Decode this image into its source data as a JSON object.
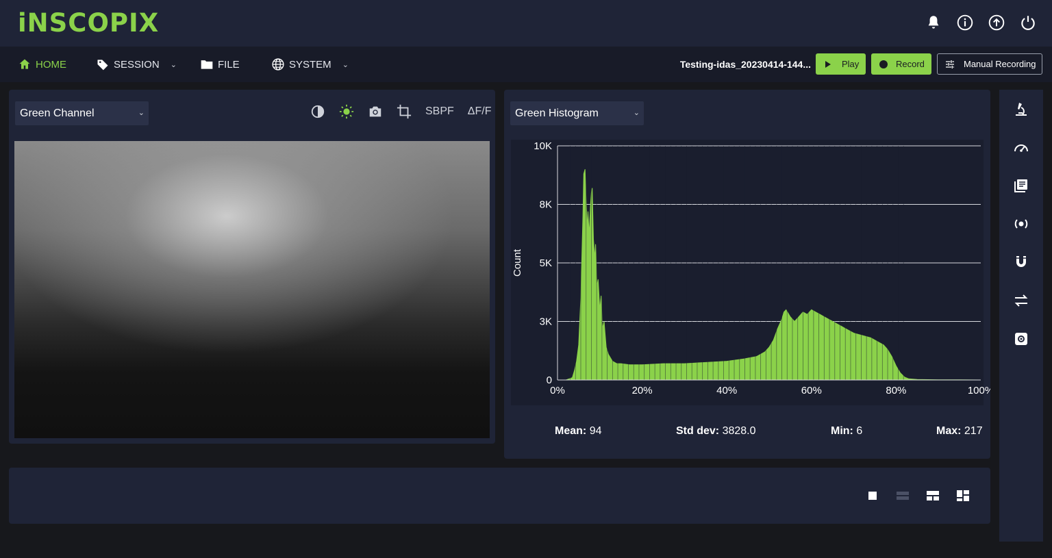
{
  "app": {
    "logo": "iNSCOPIX"
  },
  "topbar": {
    "icons": [
      "bell-icon",
      "info-icon",
      "upload-icon",
      "power-icon"
    ]
  },
  "nav": {
    "home": "HOME",
    "session": "SESSION",
    "file": "FILE",
    "system": "SYSTEM"
  },
  "session_name": "Testing-idas_20230414-144...",
  "buttons": {
    "play": "Play",
    "record": "Record",
    "manual": "Manual Recording"
  },
  "left_panel": {
    "channel_select": "Green Channel",
    "toolbar": {
      "sbpf": "SBPF",
      "dff": "ΔF/F"
    }
  },
  "right_panel": {
    "histogram_select": "Green Histogram",
    "stats": {
      "mean_label": "Mean:",
      "mean": "94",
      "std_label": "Std dev:",
      "std": "3828.0",
      "min_label": "Min:",
      "min": "6",
      "max_label": "Max:",
      "max": "217"
    }
  },
  "chart_data": {
    "type": "area",
    "ylabel": "Count",
    "xlabel": "",
    "ylim": [
      0,
      10000
    ],
    "xlim": [
      0,
      100
    ],
    "yticks": [
      "0",
      "3K",
      "5K",
      "8K",
      "10K"
    ],
    "ytick_values": [
      0,
      2500,
      5000,
      7500,
      10000
    ],
    "xticks": [
      "0%",
      "20%",
      "40%",
      "60%",
      "80%",
      "100%"
    ],
    "xtick_values": [
      0,
      20,
      40,
      60,
      80,
      100
    ],
    "grid": true,
    "color": "#8bd24a",
    "series": [
      {
        "x": [
          0,
          2,
          3.5,
          4,
          4.5,
          5,
          5.5,
          6,
          6.2,
          6.5,
          6.8,
          7,
          7.2,
          7.5,
          7.8,
          8,
          8.2,
          8.5,
          8.8,
          9,
          9.3,
          9.6,
          10,
          10.3,
          10.6,
          11,
          11.5,
          12,
          13,
          14,
          15,
          17,
          20,
          25,
          30,
          35,
          40,
          44,
          47,
          49,
          50,
          51,
          52,
          53,
          53.5,
          54,
          54.5,
          55,
          56,
          57,
          58,
          59,
          60,
          61,
          62,
          63,
          64,
          65,
          66,
          67,
          68,
          70,
          72,
          74,
          76,
          77,
          78,
          79,
          80,
          81,
          82,
          83,
          85,
          90,
          95,
          100
        ],
        "y": [
          0,
          0,
          100,
          400,
          800,
          1500,
          3500,
          7000,
          8800,
          9000,
          7500,
          6500,
          7200,
          6200,
          7500,
          8000,
          8200,
          6000,
          5200,
          5800,
          4000,
          4300,
          3000,
          3600,
          2200,
          2500,
          1400,
          1100,
          800,
          700,
          700,
          650,
          650,
          700,
          700,
          750,
          800,
          900,
          1000,
          1200,
          1400,
          1700,
          2200,
          2600,
          2900,
          3000,
          2850,
          2700,
          2500,
          2700,
          2900,
          2800,
          3000,
          2900,
          2800,
          2700,
          2600,
          2500,
          2400,
          2300,
          2200,
          2000,
          1900,
          1800,
          1600,
          1500,
          1300,
          1000,
          600,
          300,
          120,
          50,
          20,
          10,
          5,
          0
        ]
      }
    ]
  },
  "bottom_panel": {
    "layout_icons": [
      "single-layout-icon",
      "stacked-layout-icon",
      "split-layout-icon",
      "grid-layout-icon"
    ]
  },
  "sidebar": {
    "icons": [
      "microscope-icon",
      "gauge-icon",
      "library-icon",
      "broadcast-icon",
      "magnet-icon",
      "swap-icon",
      "settings-icon"
    ]
  }
}
